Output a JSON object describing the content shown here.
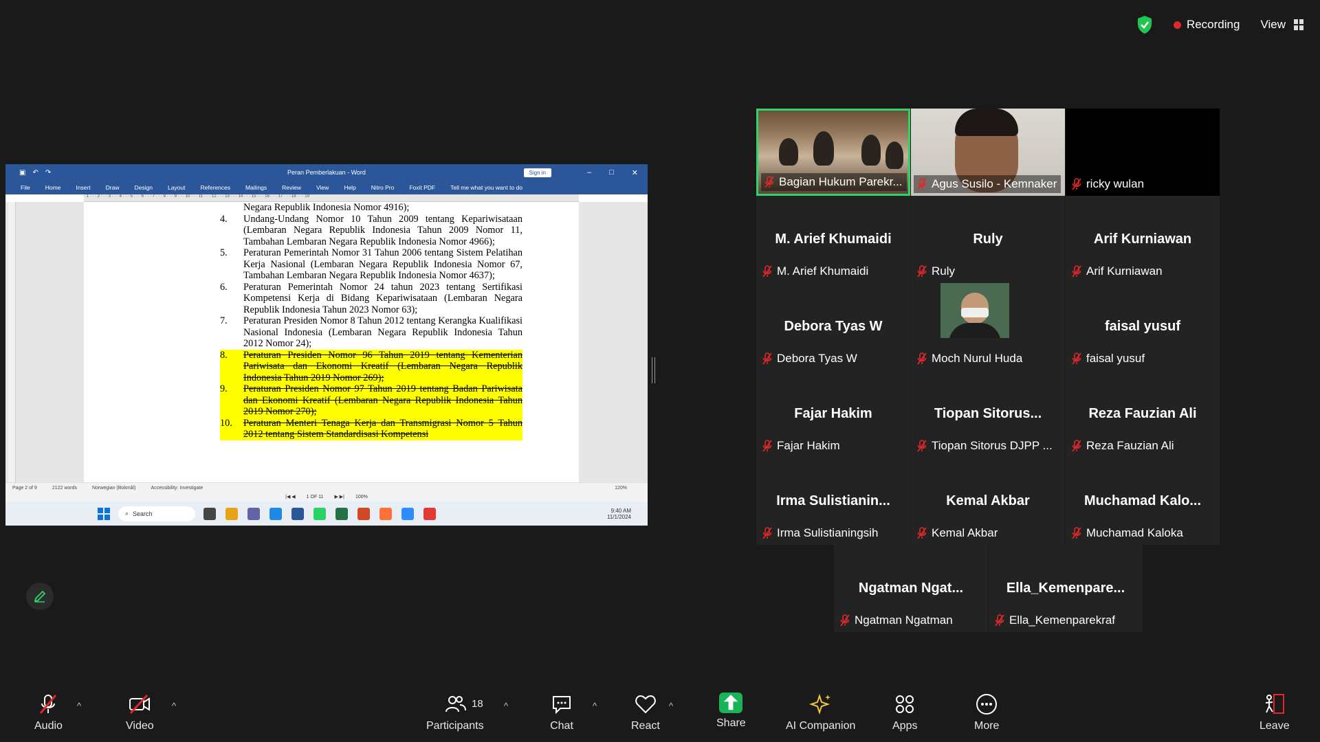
{
  "status": {
    "recording": "Recording",
    "view": "View"
  },
  "word": {
    "title": "Peran Pemberlakuan - Word",
    "signin": "Sign in",
    "menu": [
      "File",
      "Home",
      "Insert",
      "Draw",
      "Design",
      "Layout",
      "References",
      "Mailings",
      "Review",
      "View",
      "Help",
      "Nitro Pro",
      "Foxit PDF",
      "Tell me what you want to do"
    ],
    "items": [
      {
        "num": "",
        "text": "Negara Republik Indonesia Nomor 4916);",
        "hl": false
      },
      {
        "num": "4.",
        "text": "Undang-Undang Nomor 10 Tahun 2009 tentang Kepariwisataan (Lembaran Negara Republik Indonesia Tahun 2009 Nomor 11, Tambahan Lembaran Negara Republik Indonesia Nomor 4966);",
        "hl": false
      },
      {
        "num": "5.",
        "text": "Peraturan Pemerintah Nomor 31 Tahun 2006 tentang Sistem Pelatihan Kerja Nasional (Lembaran Negara Republik Indonesia Nomor 67, Tambahan Lembaran Negara Republik Indonesia Nomor 4637);",
        "hl": false
      },
      {
        "num": "6.",
        "text": "Peraturan Pemerintah Nomor 24 tahun 2023 tentang Sertifikasi Kompetensi Kerja di Bidang Kepariwisataan (Lembaran Negara Republik Indonesia Tahun 2023 Nomor 63);",
        "hl": false
      },
      {
        "num": "7.",
        "text": "Peraturan Presiden Nomor 8 Tahun 2012 tentang Kerangka Kualifikasi Nasional Indonesia (Lembaran Negara Republik Indonesia Tahun 2012 Nomor 24);",
        "hl": false
      },
      {
        "num": "8.",
        "text": "Peraturan Presiden Nomor 96 Tahun 2019 tentang Kementerian Pariwisata dan Ekonomi Kreatif (Lembaran Negara Republik Indonesia Tahun 2019 Nomor 269);",
        "hl": true
      },
      {
        "num": "9.",
        "text": "Peraturan Presiden Nomor 97 Tahun 2019 tentang Badan Pariwisata dan Ekonomi Kreatif (Lembaran Negara Republik Indonesia Tahun 2019 Nomor 270);",
        "hl": true
      },
      {
        "num": "10.",
        "text": "Peraturan Menteri Tenaga Kerja dan Transmigrasi Nomor 5 Tahun 2012 tentang Sistem Standardisasi Kompetensi",
        "hl": true
      }
    ],
    "statusbar": {
      "page": "Page 2 of 9",
      "words": "2122 words",
      "lang": "Norwegian (Bokmål)",
      "access": "Accessibility: Investigate",
      "zoom": "120%"
    },
    "pagenav": {
      "pages": "1 OF 11",
      "zoom2": "100%"
    },
    "taskbar": {
      "search": "Search",
      "time": "9:40 AM",
      "date": "11/1/2024"
    }
  },
  "participants": [
    {
      "big": "",
      "label": "Bagian Hukum Parekr...",
      "video": "room",
      "active": true
    },
    {
      "big": "",
      "label": "Agus Susilo - Kemnaker",
      "video": "face",
      "active": false
    },
    {
      "big": "",
      "label": "ricky wulan",
      "video": "none",
      "active": false
    },
    {
      "big": "M. Arief Khumaidi",
      "label": "M. Arief Khumaidi"
    },
    {
      "big": "Ruly",
      "label": "Ruly"
    },
    {
      "big": "Arif Kurniawan",
      "label": "Arif Kurniawan"
    },
    {
      "big": "Debora Tyas W",
      "label": "Debora Tyas W"
    },
    {
      "big": "",
      "label": "Moch Nurul Huda",
      "avatar": true
    },
    {
      "big": "faisal yusuf",
      "label": "faisal yusuf"
    },
    {
      "big": "Fajar Hakim",
      "label": "Fajar Hakim"
    },
    {
      "big": "Tiopan Sitorus...",
      "label": "Tiopan Sitorus DJPP ..."
    },
    {
      "big": "Reza Fauzian Ali",
      "label": "Reza Fauzian Ali"
    },
    {
      "big": "Irma Sulistianin...",
      "label": "Irma Sulistianingsih"
    },
    {
      "big": "Kemal Akbar",
      "label": "Kemal Akbar"
    },
    {
      "big": "Muchamad Kalo...",
      "label": "Muchamad Kaloka"
    },
    {
      "big": "Ngatman Ngat...",
      "label": "Ngatman Ngatman"
    },
    {
      "big": "Ella_Kemenpare...",
      "label": "Ella_Kemenparekraf"
    }
  ],
  "toolbar": {
    "audio": "Audio",
    "video": "Video",
    "participants": "Participants",
    "participant_count": "18",
    "chat": "Chat",
    "react": "React",
    "share": "Share",
    "ai": "AI Companion",
    "apps": "Apps",
    "more": "More",
    "leave": "Leave"
  },
  "colors": {
    "active_border": "#2fd36a",
    "share_green": "#19b358",
    "mute_red": "#e02828",
    "word_blue": "#2b579a",
    "highlight": "#ffff00"
  }
}
